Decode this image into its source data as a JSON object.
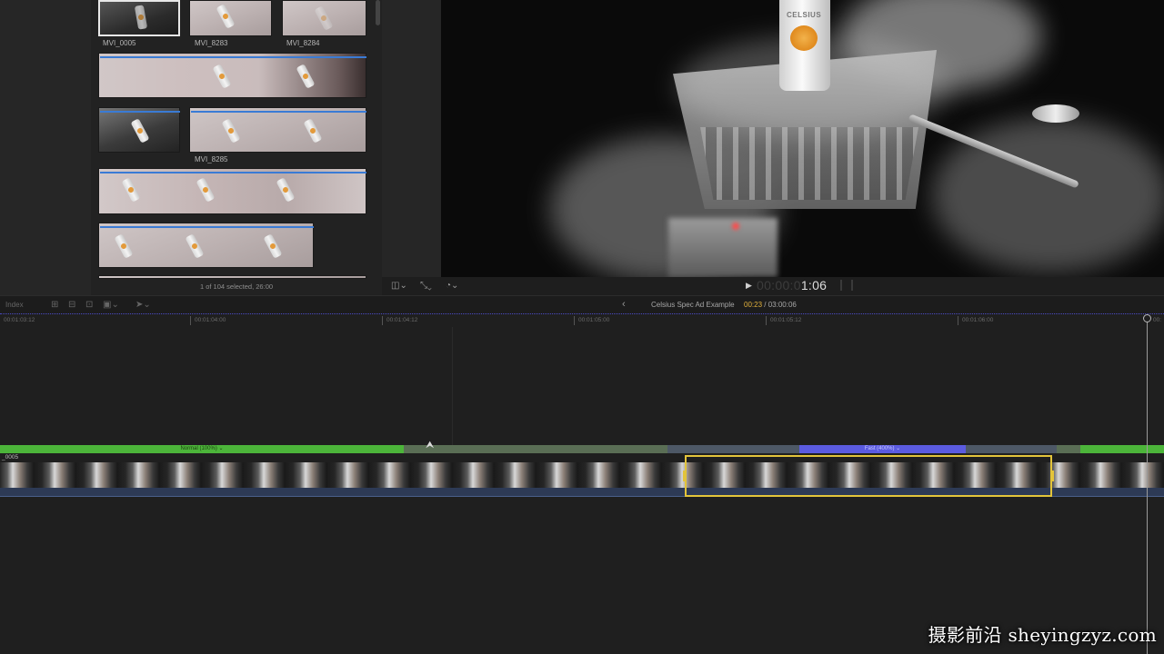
{
  "browser": {
    "clips": [
      {
        "label": "MVI_0005"
      },
      {
        "label": "MVI_8283"
      },
      {
        "label": "MVI_8284"
      },
      {
        "label": "MVI_8285"
      }
    ],
    "footer_status": "1 of 104 selected, 26:00"
  },
  "viewer": {
    "can_brand": "CELSIUS",
    "timecode_dim": "00:00:0",
    "timecode_bright": "1:06"
  },
  "timeline": {
    "index_label": "Index",
    "project_name": "Celsius Spec Ad Example",
    "current_time": "00:23",
    "total_time": "/ 03:00:06",
    "ruler_ticks": [
      "00:01:03:12",
      "00:01:04:00",
      "00:01:04:12",
      "00:01:05:00",
      "00:01:05:12",
      "00:01:06:00",
      "00:"
    ],
    "retime_normal": "Normal (100%) ⌄",
    "retime_fast": "Fast (400%) ⌄",
    "clip_name": "_0005"
  },
  "watermark": "摄影前沿 sheyingzyz.com",
  "colors": {
    "retime_normal": "#4cb53a",
    "retime_fast": "#5b5be0",
    "selection": "#e3c43a",
    "current_time": "#e3b23c"
  }
}
